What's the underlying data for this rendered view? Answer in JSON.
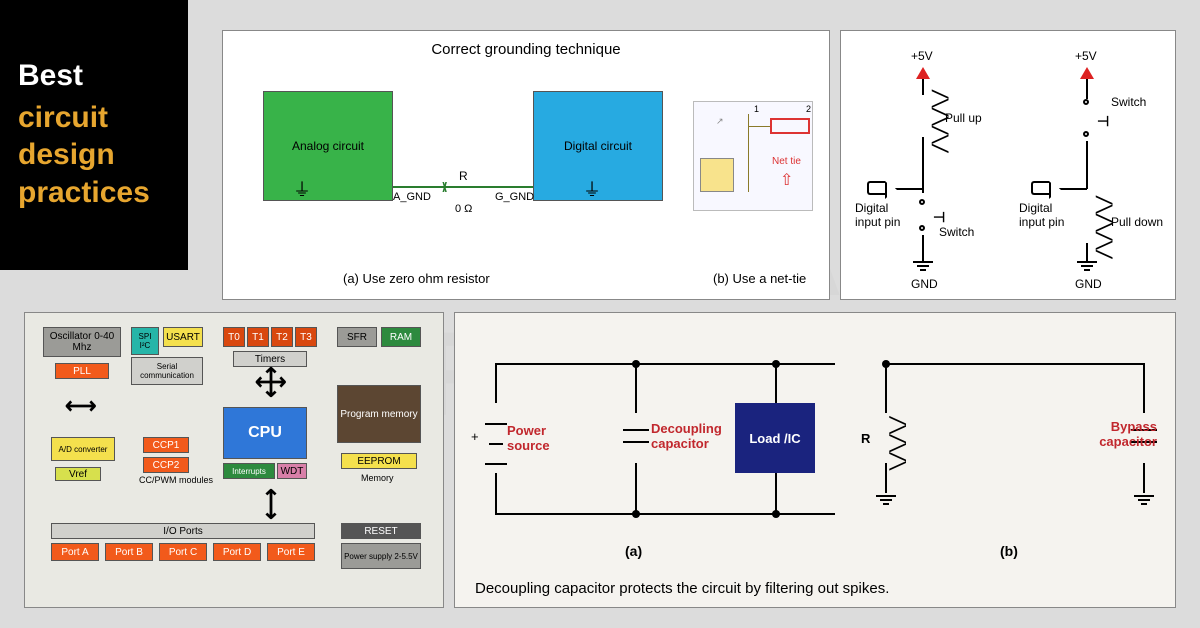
{
  "watermark": "SIERRA\nCIRCUITS",
  "title": {
    "line1": "Best",
    "line2": "circuit design practices"
  },
  "grounding": {
    "heading": "Correct grounding technique",
    "analog_label": "Analog circuit",
    "digital_label": "Digital circuit",
    "a_gnd": "A_GND",
    "g_gnd": "G_GND",
    "r_label": "R",
    "r_value": "0 Ω",
    "caption_a": "(a) Use zero ohm resistor",
    "caption_b": "(b) Use a net-tie",
    "nettie": {
      "label": "Net tie",
      "pin1": "1",
      "pin2": "2"
    }
  },
  "pull": {
    "v5_a": "+5V",
    "v5_b": "+5V",
    "pullup": "Pull up",
    "pulldown": "Pull down",
    "dip_a": "Digital input pin",
    "dip_b": "Digital input pin",
    "switch_a": "Switch",
    "switch_b": "Switch",
    "gnd_a": "GND",
    "gnd_b": "GND"
  },
  "mcu": {
    "osc": "Oscillator 0-40 Mhz",
    "pll": "PLL",
    "spi": "SPI I²C",
    "usart": "USART",
    "serial": "Serial communication",
    "t0": "T0",
    "t1": "T1",
    "t2": "T2",
    "t3": "T3",
    "timers": "Timers",
    "sfr": "SFR",
    "ram": "RAM",
    "program": "Program memory",
    "cpu": "CPU",
    "ad": "A/D converter",
    "vref": "Vref",
    "ccp1": "CCP1",
    "ccp2": "CCP2",
    "ccpwm": "CC/PWM modules",
    "interrupts": "Interrupts",
    "wdt": "WDT",
    "eeprom": "EEPROM",
    "memory": "Memory",
    "ioports": "I/O Ports",
    "pa": "Port A",
    "pb": "Port B",
    "pc": "Port C",
    "pd": "Port D",
    "pe": "Port E",
    "reset": "RESET",
    "psu": "Power supply 2-5.5V"
  },
  "decouple": {
    "power": "Power source",
    "dcap": "Decoupling capacitor",
    "load": "Load /IC",
    "r": "R",
    "bcap": "Bypass capacitor",
    "plus": "+",
    "cap_a": "(a)",
    "cap_b": "(b)",
    "caption": "Decoupling capacitor protects the circuit by filtering out spikes."
  }
}
